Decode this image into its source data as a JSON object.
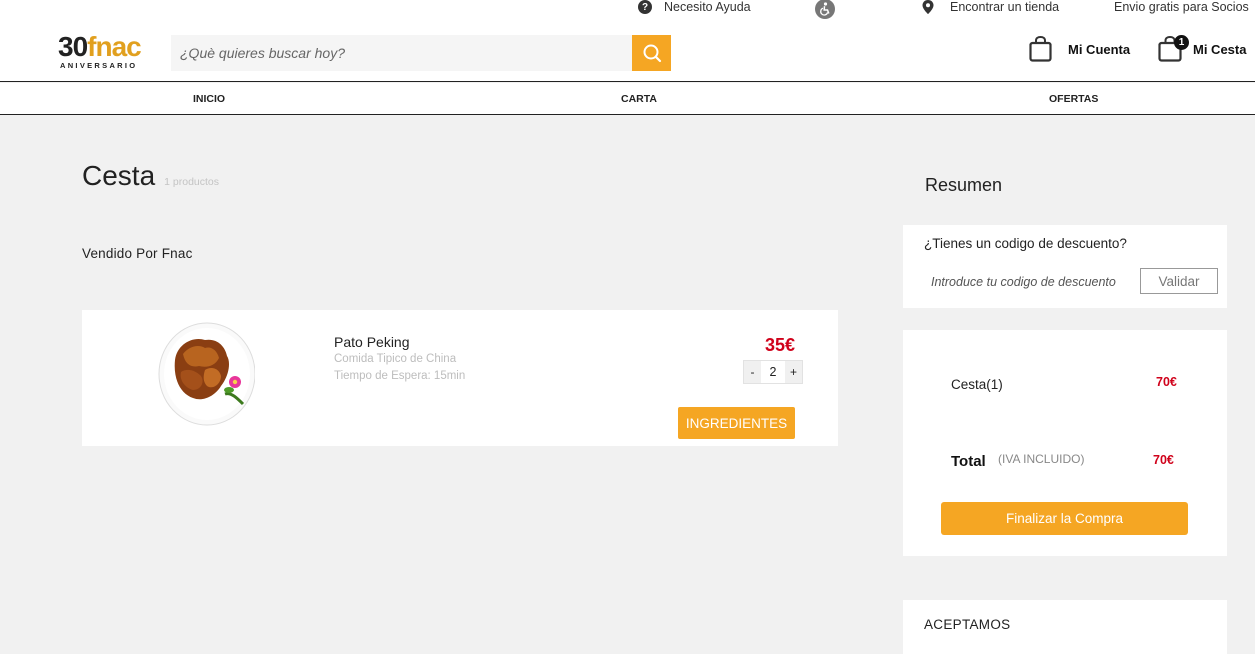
{
  "utility_bar": {
    "help": "Necesito Ayuda",
    "store": "Encontrar un tienda",
    "shipping": "Envio gratis para Socios"
  },
  "logo": {
    "number": "30",
    "brand": "fnac",
    "tagline": "ANIVERSARIO"
  },
  "search": {
    "placeholder": "¿Què quieres buscar hoy?"
  },
  "account": {
    "label": "Mi Cuenta"
  },
  "basket": {
    "label": "Mi Cesta",
    "count": "1"
  },
  "nav": {
    "items": [
      "INICIO",
      "CARTA",
      "OFERTAS"
    ]
  },
  "cart": {
    "title": "Cesta",
    "count_text": "1 productos",
    "seller": "Vendido Por Fnac",
    "item": {
      "name": "Pato Peking",
      "description": "Comida Tipico de China",
      "wait": "Tiempo de Espera: 15min",
      "price": "35€",
      "qty": "2",
      "minus": "-",
      "plus": "+",
      "ingredients_label": "INGREDIENTES"
    }
  },
  "summary": {
    "title": "Resumen",
    "discount_question": "¿Tienes un codigo de descuento?",
    "discount_placeholder": "Introduce tu codigo de descuento",
    "validate_label": "Validar",
    "basket_label": "Cesta(1)",
    "basket_value": "70€",
    "total_label": "Total",
    "tax_note": "(IVA INCLUIDO)",
    "total_value": "70€",
    "checkout_label": "Finalizar la Compra",
    "accepted_label": "ACEPTAMOS"
  },
  "colors": {
    "accent": "#f5a623",
    "price": "#d0021b",
    "background": "#f1f1f1"
  },
  "icons": [
    "help-icon",
    "accessibility-icon",
    "location-pin-icon",
    "search-icon",
    "account-bag-icon",
    "basket-bag-icon"
  ]
}
